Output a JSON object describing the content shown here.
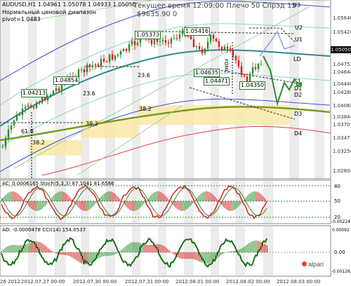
{
  "header": {
    "symbol_line": "AUDUSD,H1  1.04961 1.05078 1.04933 1.05050",
    "subtitle": "Нормальный ценовой диапазон",
    "pivot": "pivot=1.0483",
    "info_line1": "Текущее время 12:09:00 Плечо 50 Спрэд 13",
    "info_line2": "$9635.90  0"
  },
  "price_axis": [
    "1.05640",
    "1.05420",
    "1.05050",
    "1.04752",
    "1.04644",
    "1.04440",
    "1.04280",
    "1.04068",
    "1.03844",
    "1.03707",
    "1.03477",
    "1.03254",
    "1.03028",
    "1.02804"
  ],
  "current_price": "1.05050",
  "right_levels": [
    "U3",
    "U2",
    "U1",
    "LD",
    "S1",
    "D1",
    "D2",
    "D3",
    "D4",
    "C"
  ],
  "left_pivots": [
    "38.2",
    "61.8"
  ],
  "center_pivots": [
    "23.6",
    "23.6",
    "38.2",
    "38.2"
  ],
  "price_labels": [
    "1.04213",
    "1.04854",
    "1.05373",
    "1.05416",
    "1.04635",
    "1.04471",
    "1.04350"
  ],
  "event_label": "FOMC",
  "panel2": {
    "title": "AC: 0.0006165  Stoch(5,3,3) 87.1041  81.6586",
    "scale": [
      "80",
      "50",
      "20",
      "-0.00224"
    ]
  },
  "panel3": {
    "title": "AO: -0.0000478  CCI(14) 154.0537",
    "scale": [
      "0.00092",
      "0.00",
      "-0.001263"
    ],
    "brand": "alpari"
  },
  "dates": [
    "26 2012",
    "2012.07.27 00:00",
    "2012.07.30 00:00",
    "2012.07.31 00:00",
    "2012.08.01 00:00",
    "2012.08.02 00:00",
    "2012.08.03 00:00"
  ],
  "colors": {
    "bull": "#2c8c2c",
    "bear": "#d42020",
    "channel": "#4aa0a0",
    "blue": "#3a4fd0",
    "olive": "#7a9a20"
  }
}
